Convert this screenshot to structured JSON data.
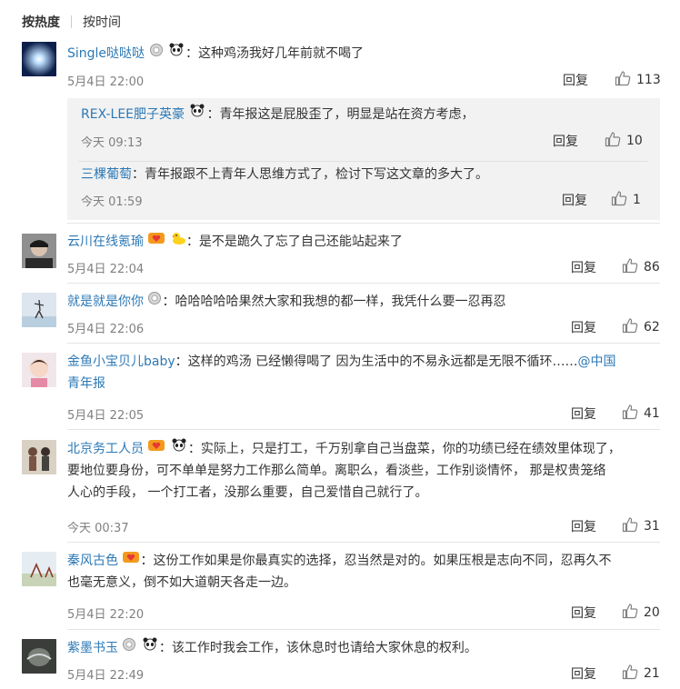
{
  "sort": {
    "hot": "按热度",
    "time": "按时间"
  },
  "comments": [
    {
      "user": "Single哒哒哒",
      "sep": "：",
      "text": "这种鸡汤我好几年前就不喝了",
      "time": "5月4日 22:00",
      "reply": "回复",
      "likes": "113"
    },
    {
      "user": "云川在线氪瑜",
      "sep": "：",
      "text": "是不是跪久了忘了自己还能站起来了",
      "time": "5月4日 22:04",
      "reply": "回复",
      "likes": "86"
    },
    {
      "user": "就是就是你你",
      "sep": "：",
      "text": "哈哈哈哈哈果然大家和我想的都一样，我凭什么要一忍再忍",
      "time": "5月4日 22:06",
      "reply": "回复",
      "likes": "62"
    },
    {
      "user": "金鱼小宝贝儿baby",
      "sep": "：",
      "text": "这样的鸡汤 已经懒得喝了 因为生活中的不易永远都是无限不循环……",
      "mention1": "@中国",
      "mention2": "青年报",
      "time": "5月4日 22:05",
      "reply": "回复",
      "likes": "41"
    },
    {
      "user": "北京务工人员",
      "sep": "：",
      "text1": "实际上，只是打工，千万别拿自己当盘菜，你的功绩已经在绩效里体现了，",
      "text2": "要地位要身份，可不单单是努力工作那么简单。离职么，看淡些，工作别谈情怀， 那是权贵笼络",
      "text3": "人心的手段， 一个打工者，没那么重要，自己爱惜自己就行了。",
      "time": "今天 00:37",
      "reply": "回复",
      "likes": "31"
    },
    {
      "user": "秦风古色",
      "sep": "：",
      "text1": "这份工作如果是你最真实的选择，忍当然是对的。如果压根是志向不同，忍再久不",
      "text2": "也毫无意义，倒不如大道朝天各走一边。",
      "time": "5月4日 22:20",
      "reply": "回复",
      "likes": "20"
    },
    {
      "user": "紫墨书玉",
      "sep": "：",
      "text": "该工作时我会工作，该休息时也请给大家休息的权利。",
      "time": "5月4日 22:49",
      "reply": "回复",
      "likes": "21"
    }
  ],
  "subreplies": [
    {
      "user": "REX-LEE肥子英豪",
      "sep": "：",
      "text": "青年报这是屁股歪了，明显是站在资方考虑，",
      "time": "今天 09:13",
      "reply": "回复",
      "likes": "10"
    },
    {
      "user": "三棵葡萄",
      "sep": "：",
      "text": "青年报跟不上青年人思维方式了，检讨下写这文章的多大了。",
      "time": "今天 01:59",
      "reply": "回复",
      "likes": "1"
    }
  ],
  "icons": {
    "like": "thumbs-up-icon",
    "medal": "medal-icon",
    "panda": "panda-icon",
    "duck": "duck-icon",
    "vip": "vip-heart-icon"
  },
  "colors": {
    "username": "#2c78b5",
    "meta": "#808080",
    "subbox": "#f2f2f2",
    "divider": "#e5e5e5"
  }
}
